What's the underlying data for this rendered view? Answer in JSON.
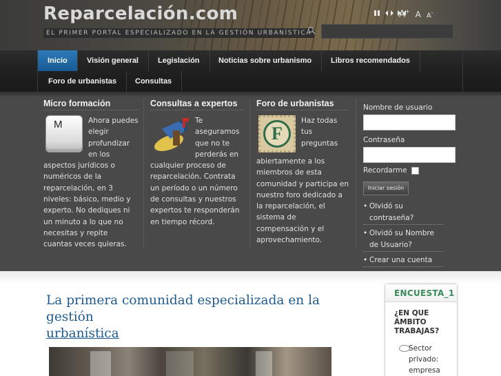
{
  "header": {
    "site_title": "Reparcelación.com",
    "tagline": "EL PRIMER PORTAL ESPECIALIZADO EN LA GESTIÓN URBANÍSTICA",
    "font_controls": {
      "increase": "A",
      "reset": "A",
      "decrease": "A"
    },
    "search": {
      "placeholder": ""
    }
  },
  "nav": {
    "items": [
      {
        "label": "Inicio",
        "active": true
      },
      {
        "label": "Visión general"
      },
      {
        "label": "Legislación"
      },
      {
        "label": "Noticias sobre urbanismo"
      },
      {
        "label": "Libros recomendados"
      },
      {
        "label": "Foro de urbanistas"
      },
      {
        "label": "Consultas"
      }
    ]
  },
  "panel": {
    "micro": {
      "title": "Micro formación",
      "key_letter": "M",
      "text": "Ahora puedes elegir profundizar en los aspectos jurídicos o numéricos de la reparcelación, en 3 niveles: básico, medio y experto. No dediques ni un minuto a lo que no necesitas y repite cuantas veces quieras."
    },
    "consultas": {
      "title": "Consultas a expertos",
      "text": "Te aseguramos que no te perderás en cualquier proceso de reparcelación. Contrata un período o un número de consultas y nuestros expertos te responderán en tiempo récord."
    },
    "foro": {
      "title": "Foro de urbanistas",
      "stamp_letter": "F",
      "text": "Haz todas tus preguntas abiertamente a los miembros de esta comunidad y participa en nuestro foro dedicado a la reparcelación, el sistema de compensación y el aprovechamiento."
    },
    "login": {
      "username_label": "Nombre de usuario",
      "password_label": "Contraseña",
      "remember_label": "Recordarme",
      "button": "Iniciar sesión",
      "links": [
        "Olvidó su contraseña?",
        "Olvidó su Nombre de Usuario?",
        "Crear una cuenta"
      ]
    }
  },
  "main": {
    "article_title_line1": "La primera comunidad especializada en la gestión",
    "article_title_line2": "urbanística"
  },
  "poll": {
    "title": "ENCUESTA_1",
    "question": "¿EN QUE ÁMBITO TRABAJAS?",
    "option1": "Sector privado: empresa"
  }
}
